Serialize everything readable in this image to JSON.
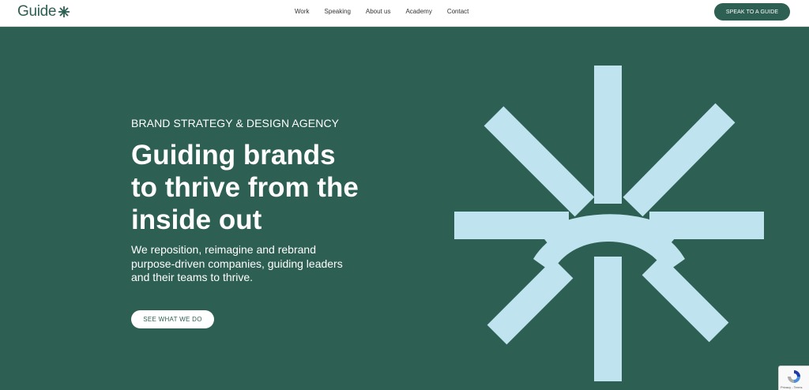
{
  "header": {
    "logo_text": "Guide",
    "logo_icon": "asterisk-icon",
    "nav": [
      {
        "label": "Work"
      },
      {
        "label": "Speaking"
      },
      {
        "label": "About us"
      },
      {
        "label": "Academy"
      },
      {
        "label": "Contact"
      }
    ],
    "cta_label": "SPEAK TO A GUIDE"
  },
  "hero": {
    "eyebrow": "BRAND STRATEGY & DESIGN AGENCY",
    "headline_lines": [
      "Guiding brands",
      "to thrive from the",
      "inside out"
    ],
    "subtext_lines": [
      "We reposition, reimagine and rebrand",
      "purpose-driven companies, guiding leaders",
      "and their teams to thrive."
    ],
    "button_label": "SEE WHAT WE DO",
    "graphic_icon": "guide-asterisk-icon"
  },
  "recaptcha": {
    "icon": "recaptcha-icon",
    "links": "Privacy - Terms"
  },
  "colors": {
    "brand_green": "#2d5f52",
    "accent_light_blue": "#bfe3ef",
    "white": "#ffffff"
  }
}
